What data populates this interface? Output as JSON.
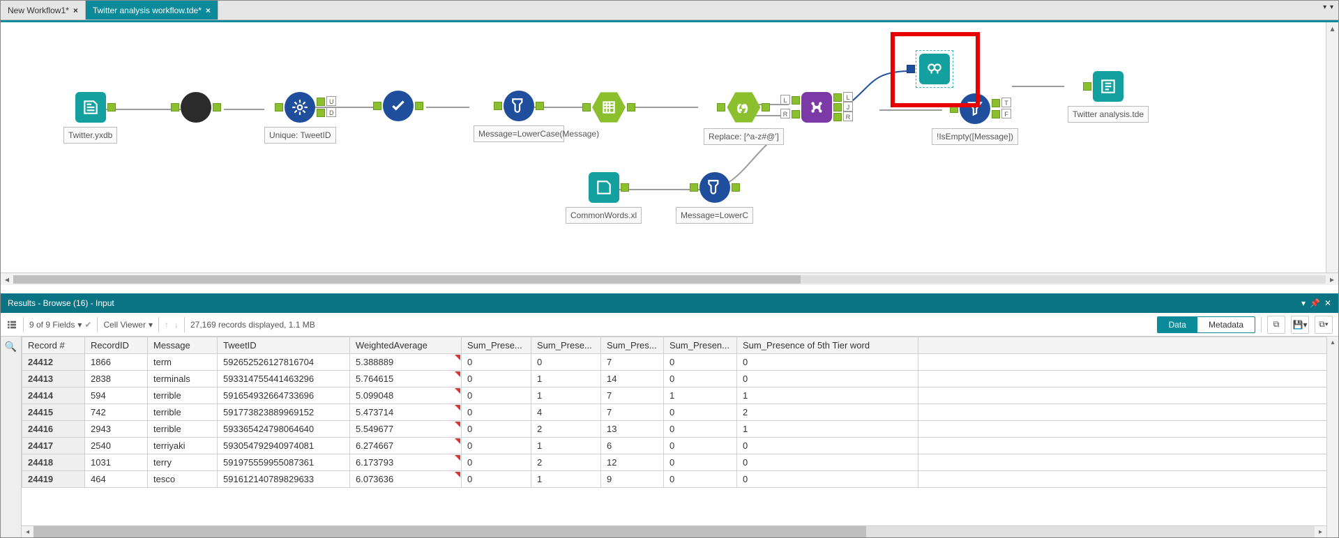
{
  "tabs": [
    {
      "label": "New Workflow1*"
    },
    {
      "label": "Twitter analysis workflow.tde*"
    }
  ],
  "nodes": {
    "input": {
      "label": "Twitter.yxdb"
    },
    "unique": {
      "label": "Unique: TweetID"
    },
    "formula1": {
      "label": "Message=LowerCase(Message)"
    },
    "replace": {
      "label": "Replace: [^a-z#@']"
    },
    "filter": {
      "label": "!IsEmpty([Message])"
    },
    "output": {
      "label": "Twitter analysis.tde"
    },
    "common": {
      "label": "CommonWords.xl"
    },
    "formula2": {
      "label": "Message=LowerC"
    },
    "anchors": {
      "u": "U",
      "d": "D",
      "l": "L",
      "j": "J",
      "r": "R",
      "f": "F",
      "t": "T"
    }
  },
  "results_title": "Results - Browse (16) - Input",
  "toolbar": {
    "fields": "9 of 9 Fields",
    "cell_viewer": "Cell Viewer",
    "status": "27,169 records displayed, 1.1 MB",
    "data": "Data",
    "metadata": "Metadata"
  },
  "columns": [
    "Record #",
    "RecordID",
    "Message",
    "TweetID",
    "WeightedAverage",
    "Sum_Prese...",
    "Sum_Prese...",
    "Sum_Pres...",
    "Sum_Presen...",
    "Sum_Presence of 5th Tier word"
  ],
  "rows": [
    [
      "24412",
      "1866",
      "term",
      "592652526127816704",
      "5.388889",
      "0",
      "0",
      "7",
      "0",
      "0"
    ],
    [
      "24413",
      "2838",
      "terminals",
      "593314755441463296",
      "5.764615",
      "0",
      "1",
      "14",
      "0",
      "0"
    ],
    [
      "24414",
      "594",
      "terrible",
      "591654932664733696",
      "5.099048",
      "0",
      "1",
      "7",
      "1",
      "1"
    ],
    [
      "24415",
      "742",
      "terrible",
      "591773823889969152",
      "5.473714",
      "0",
      "4",
      "7",
      "0",
      "2"
    ],
    [
      "24416",
      "2943",
      "terrible",
      "593365424798064640",
      "5.549677",
      "0",
      "2",
      "13",
      "0",
      "1"
    ],
    [
      "24417",
      "2540",
      "terriyaki",
      "593054792940974081",
      "6.274667",
      "0",
      "1",
      "6",
      "0",
      "0"
    ],
    [
      "24418",
      "1031",
      "terry",
      "591975559955087361",
      "6.173793",
      "0",
      "2",
      "12",
      "0",
      "0"
    ],
    [
      "24419",
      "464",
      "tesco",
      "591612140789829633",
      "6.073636",
      "0",
      "1",
      "9",
      "0",
      "0"
    ]
  ]
}
